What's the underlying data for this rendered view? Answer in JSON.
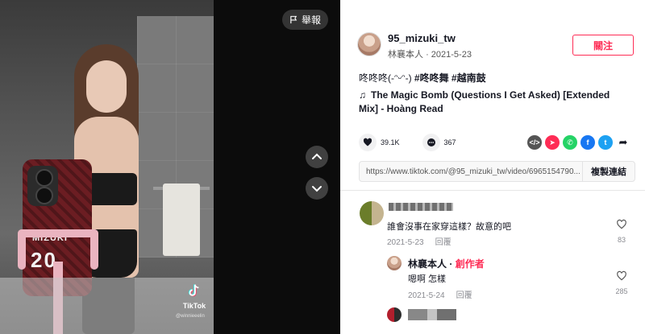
{
  "video": {
    "report_label": "舉報",
    "tiktok_brand": "TikTok",
    "tiktok_handle": "@winnieeelin",
    "phone_case_text": "MIZUKI",
    "phone_case_number": "20"
  },
  "author": {
    "id": "95_mizuki_tw",
    "display_name": "林襄本人",
    "date": "2021-5-23",
    "follow_label": "關注"
  },
  "post": {
    "caption_prefix": "咚咚咚(-ᵔᵕᵔ-) ",
    "hashtags": "#咚咚舞 #越南鼓",
    "music_title": "The Magic Bomb (Questions I Get Asked) [Extended Mix] - Hoàng Read"
  },
  "stats": {
    "likes": "39.1K",
    "comments": "367"
  },
  "share_icons": [
    "embed-icon",
    "send-icon",
    "whatsapp-icon",
    "facebook-icon",
    "twitter-icon",
    "share-arrow-icon"
  ],
  "link": {
    "url": "https://www.tiktok.com/@95_mizuki_tw/video/6965154790...",
    "copy_label": "複製連結"
  },
  "comments": [
    {
      "text": "誰會沒事在家穿這樣？故意的吧",
      "date": "2021-5-23",
      "reply_label": "回覆",
      "like_count": "83"
    },
    {
      "author": "林襄本人",
      "separator": " · ",
      "creator_badge": "創作者",
      "text": "嗯啊 怎樣",
      "date": "2021-5-24",
      "reply_label": "回覆",
      "like_count": "285"
    }
  ],
  "colors": {
    "accent": "#fe2c55",
    "text": "#161823",
    "muted": "#8a8b91"
  }
}
